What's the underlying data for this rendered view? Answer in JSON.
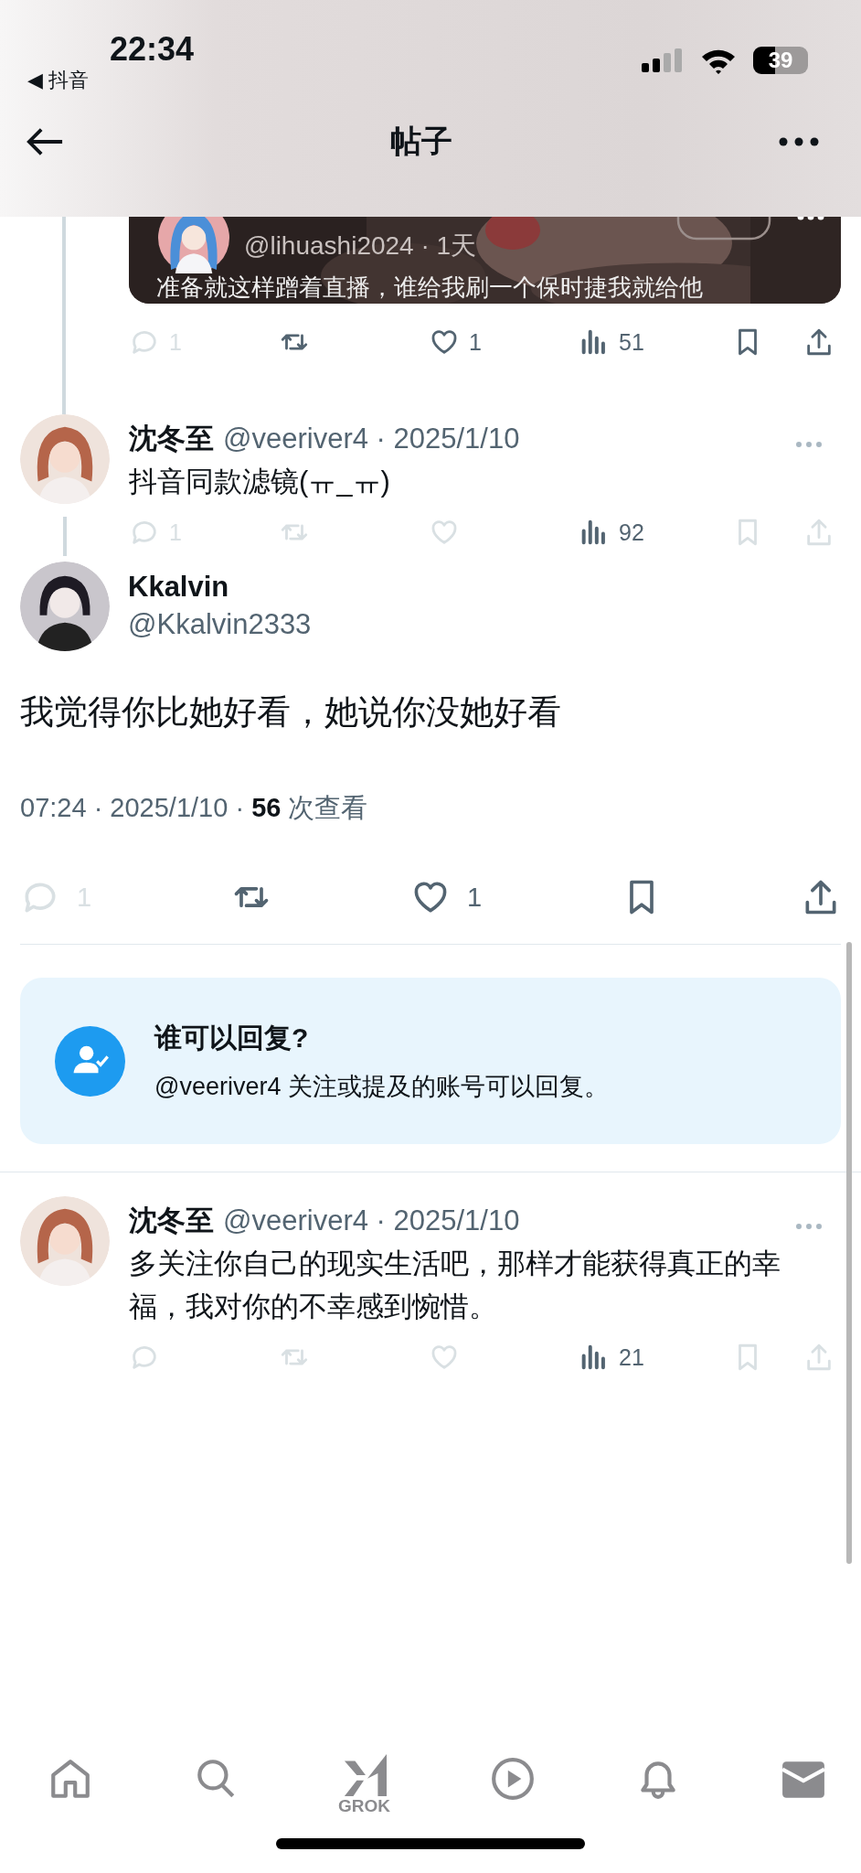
{
  "status_bar": {
    "time": "22:34",
    "back_app": "◀ 抖音",
    "battery": "39"
  },
  "header": {
    "title": "帖子"
  },
  "quoted_post": {
    "handle": "@lihuashi2024 · 1天",
    "text": "准备就这样蹭着直播，谁给我刷一个保时捷我就给他",
    "actions": [
      {
        "kind": "reply",
        "count": "1",
        "faded": true
      },
      {
        "kind": "retweet",
        "faded": false
      },
      {
        "kind": "like",
        "count": "1",
        "faded": false
      },
      {
        "kind": "views",
        "count": "51",
        "faded": false
      },
      {
        "kind": "bookmark",
        "faded": false
      },
      {
        "kind": "share",
        "faded": false
      }
    ]
  },
  "reply_above": {
    "name": "沈冬至",
    "byline": "@veeriver4 · 2025/1/10",
    "text": "抖音同款滤镜(ㅠ_ㅠ)",
    "actions": [
      {
        "kind": "reply",
        "count": "1",
        "faded": true
      },
      {
        "kind": "retweet",
        "faded": true
      },
      {
        "kind": "like",
        "faded": true
      },
      {
        "kind": "views",
        "count": "92",
        "faded": false
      },
      {
        "kind": "bookmark",
        "faded": true
      },
      {
        "kind": "share",
        "faded": true
      }
    ]
  },
  "main_post": {
    "name": "Kkalvin",
    "handle": "@Kkalvin2333",
    "text": "我觉得你比她好看，她说你没她好看",
    "meta": "07:24 · 2025/1/10 · **56** 次查看",
    "actions": [
      {
        "kind": "reply",
        "count": "1",
        "faded": true
      },
      {
        "kind": "retweet",
        "faded": false
      },
      {
        "kind": "like",
        "count": "1",
        "faded": false
      },
      {
        "kind": "bookmark",
        "faded": false
      },
      {
        "kind": "share",
        "faded": false
      }
    ]
  },
  "reply_restriction": {
    "title": "谁可以回复?",
    "text": "@veeriver4 关注或提及的账号可以回复。"
  },
  "replies": [
    {
      "name": "沈冬至",
      "byline": "@veeriver4 · 2025/1/10",
      "text": "多关注你自己的现实生活吧，那样才能获得真正的幸福，我对你的不幸感到惋惜。",
      "actions": [
        {
          "kind": "reply",
          "faded": true
        },
        {
          "kind": "retweet",
          "faded": true
        },
        {
          "kind": "like",
          "faded": true
        },
        {
          "kind": "views",
          "count": "21",
          "faded": false
        },
        {
          "kind": "bookmark",
          "faded": true
        },
        {
          "kind": "share",
          "faded": true
        }
      ]
    }
  ],
  "bottom_nav": [
    {
      "kind": "home"
    },
    {
      "kind": "search"
    },
    {
      "kind": "grok",
      "label": "GROK"
    },
    {
      "kind": "video"
    },
    {
      "kind": "notifications"
    },
    {
      "kind": "messages"
    }
  ]
}
